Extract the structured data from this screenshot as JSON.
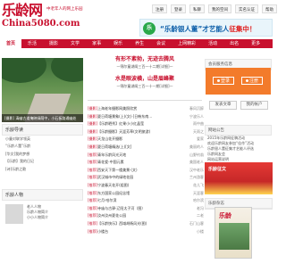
{
  "logo": {
    "main": "乐龄网",
    "slogan": "中老年人的网上乐园",
    "url": "China5080.com"
  },
  "toplinks": [
    "注册",
    "登录",
    "私聊",
    "我的空间",
    "实名认证",
    "帮助"
  ],
  "banner": {
    "prefix": "“乐龄银人董”",
    "text": "才艺能人",
    "suffix": "征集中！"
  },
  "nav": {
    "items": [
      "首页",
      "乐活",
      "摄影",
      "文学",
      "家事",
      "娱乐",
      "养生",
      "会议",
      "上网精彩",
      "活动",
      "出名",
      "更多"
    ],
    "user": "登录  注册"
  },
  "photo": {
    "caption": "[摄影] 清幽古道掩映绿荫中，小石板路通幽处"
  },
  "headline": {
    "title1": "有形不紊勃，无迹去腾风",
    "sub1": "—锦尔童湖阁三百一十二期[详细]—",
    "title2": "水是眼波横，山是眉峰聚",
    "sub2": "—锦尔童湖阁三百一十一期[详细]—"
  },
  "news": [
    {
      "tag": "[摄影]",
      "title": "上海老年摄影网美照欣赏",
      "src": "春风沉醉"
    },
    {
      "tag": "[摄影]",
      "title": "夏日荷塘景象(上)(文)·[日韩东南…",
      "src": "宁波乐人"
    },
    {
      "tag": "[摄影]",
      "title": "【乐龄晒秀】红果小小红晶莹",
      "src": "雨中曲"
    },
    {
      "tag": "[摄影]",
      "title": "【乐龄摄影】天涯芳草(文明旅游)",
      "src": "天雨之"
    },
    {
      "tag": "[摄影]",
      "title": "天龙山花开摄影",
      "src": "爱家"
    },
    {
      "tag": "[摄影]",
      "title": "夏日荷塘精选(上)[文]",
      "src": "美丽的人"
    },
    {
      "tag": "[推荐]",
      "title": "青年乐龄风光天地",
      "src": "山野钓翁"
    },
    {
      "tag": "[推荐]",
      "title": "青花瓷-中国元素",
      "src": "美国老人"
    },
    {
      "tag": "[推荐]",
      "title": "西安天下第一楼美景·(文)",
      "src": "汉中老乐"
    },
    {
      "tag": "[推荐]",
      "title": "武汉城市中的绿地花园",
      "src": "兰州游客"
    },
    {
      "tag": "[推荐]",
      "title": "宁波春天花开(组图)",
      "src": "花儿飞"
    },
    {
      "tag": "[推荐]",
      "title": "东方国家公园纪念馆",
      "src": "天涯客"
    },
    {
      "tag": "[推荐]",
      "title": "七月·哈尔滨",
      "src": "哈尔滨"
    },
    {
      "tag": "[推荐]",
      "title": "寺庙与古驿·辽阳太子河（图）",
      "src": "老冯"
    },
    {
      "tag": "[推荐]",
      "title": "汝州汝州夏花公园",
      "src": "二老"
    },
    {
      "tag": "[推荐]",
      "title": "【乐龄快乐】西域胡杨风光(图)",
      "src": "石门山客"
    },
    {
      "tag": "[推荐]",
      "title": "小楼台",
      "src": "小楼"
    }
  ],
  "right_member": {
    "title": "会员服务信息",
    "login": "登录",
    "register": "注册",
    "post": "发表文章",
    "account": "我的帐户"
  },
  "right_notice": {
    "title": "网站公告",
    "items": [
      "2015年乐龄网征稿活动",
      "欢迎乐龄网友参加“佳作”活动",
      "乐龄银人董征集才艺能人评选",
      "乐龄网友会",
      "网站运营说明"
    ]
  },
  "right_promo": {
    "text": "乐龄征文"
  },
  "right_paper": {
    "title": "乐龄杂志",
    "cover_title": "乐龄"
  },
  "left_sec1": {
    "title": "乐龄导读",
    "items": [
      "小童对联学领英",
      "“乐龄人董”乐龄",
      "[华文]我的梦想",
      "【乐龄】我的日记",
      "[诗]乐龄之歌"
    ]
  },
  "left_sec2": {
    "title": "乐龄人物",
    "name": "老人人物",
    "desc1": "乐龄人物简介",
    "desc2": "小小人物简介"
  }
}
